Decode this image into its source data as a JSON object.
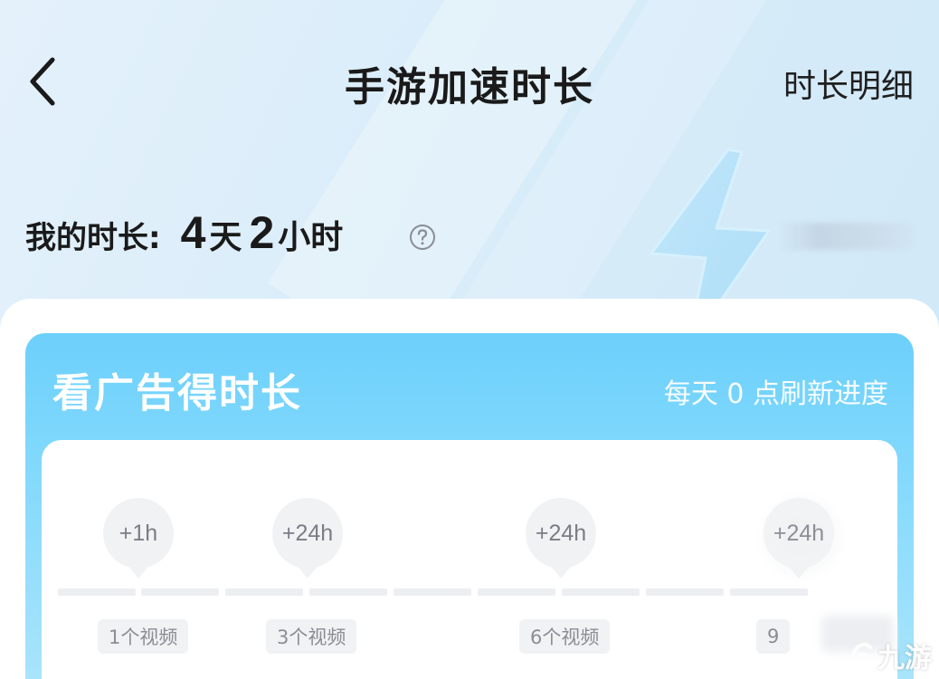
{
  "header": {
    "title": "手游加速时长",
    "detail_link": "时长明细"
  },
  "my_duration": {
    "label": "我的时长:",
    "days_value": "4",
    "days_unit": "天",
    "hours_value": "2",
    "hours_unit": "小时",
    "help_icon": "question-circle-icon"
  },
  "ad_card": {
    "title": "看广告得时长",
    "refresh_note": "每天 0 点刷新进度",
    "milestones": [
      {
        "reward": "+1h",
        "requirement": "1个视频"
      },
      {
        "reward": "+24h",
        "requirement": "3个视频"
      },
      {
        "reward": "+24h",
        "requirement": "6个视频"
      },
      {
        "reward": "+24h",
        "requirement": "9"
      }
    ],
    "progress_segments_total": 9,
    "progress_segments_filled": 0
  },
  "watermark": {
    "text": "九游"
  },
  "colors": {
    "card_accent": "#6cd0fb",
    "track": "#eceef1",
    "bubble_bg": "#f1f2f4"
  }
}
